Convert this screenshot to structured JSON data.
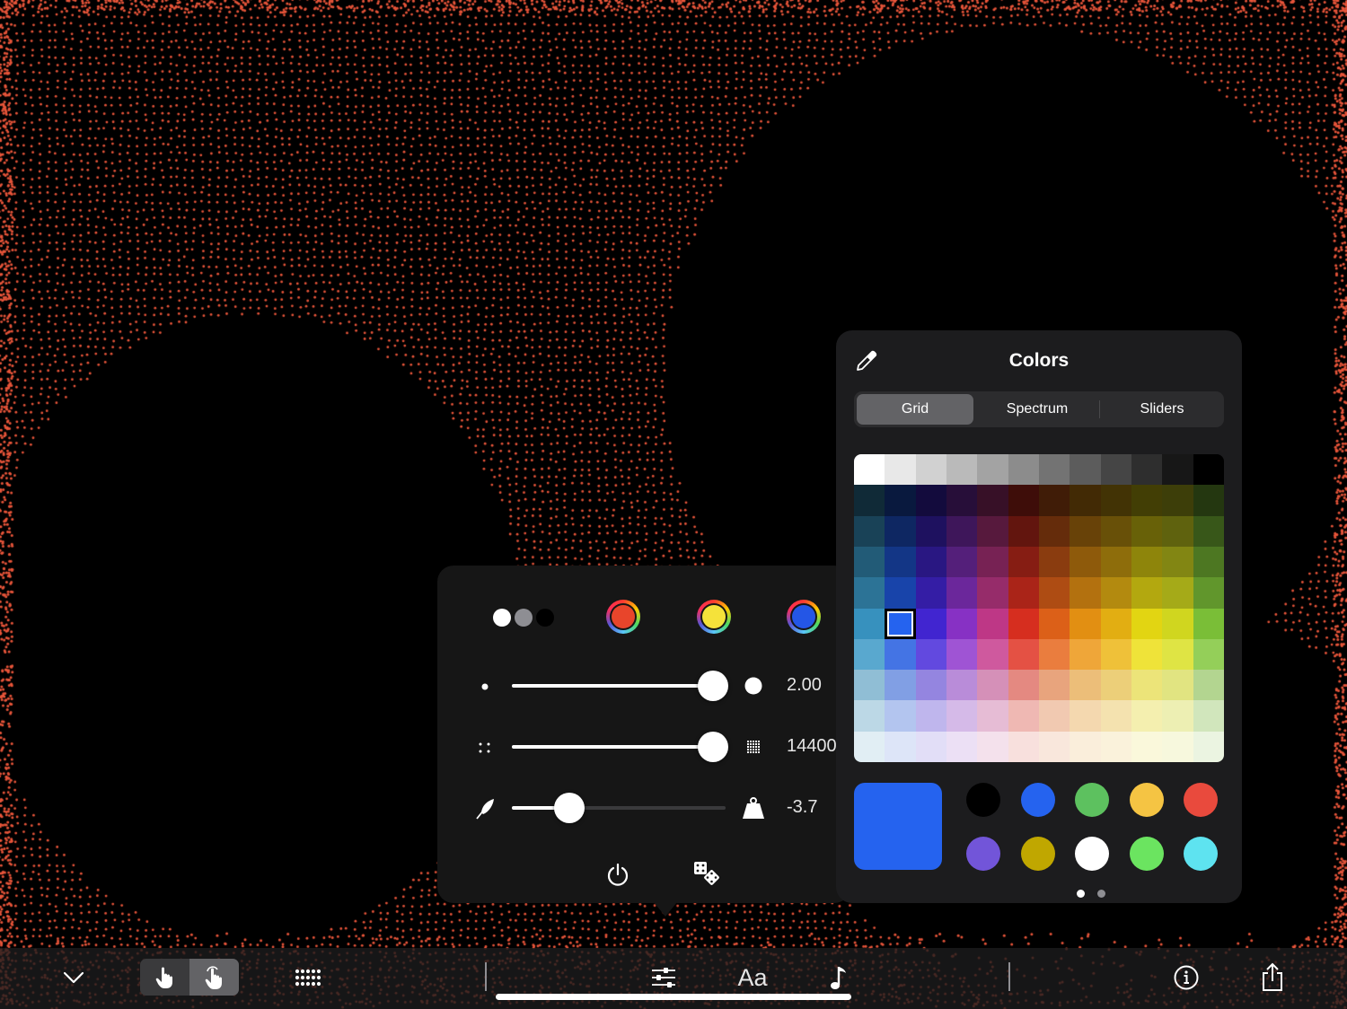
{
  "canvas": {
    "particle_color": "#e8553a",
    "background": "#000000"
  },
  "settings": {
    "point_sizes": [
      "#ffffff",
      "#8e8e93",
      "#000000"
    ],
    "active_colors": [
      {
        "name": "red",
        "color": "#e8452b"
      },
      {
        "name": "yellow",
        "color": "#f5e23a"
      },
      {
        "name": "blue",
        "color": "#2456e6"
      }
    ],
    "sliders": [
      {
        "name": "size",
        "left_icon": "small-dot-icon",
        "right_icon": "large-dot-icon",
        "fraction": 0.94,
        "value": "2.00"
      },
      {
        "name": "count",
        "left_icon": "sparse-dots-icon",
        "right_icon": "dense-grid-icon",
        "fraction": 0.94,
        "value": "14400"
      },
      {
        "name": "gravity",
        "left_icon": "feather-icon",
        "right_icon": "weight-icon",
        "fraction": 0.27,
        "value": "-3.7"
      }
    ],
    "bottom_buttons": [
      "power-icon",
      "shuffle-icon"
    ]
  },
  "colors": {
    "title": "Colors",
    "tabs": [
      "Grid",
      "Spectrum",
      "Sliders"
    ],
    "selected_tab": "Grid",
    "selected_cell": {
      "row": 5,
      "col": 1
    },
    "current_color": "#2563ef",
    "favorites": [
      "#000000",
      "#2563ef",
      "#5dc15f",
      "#f5c443",
      "#e94a3d",
      "#7255d9",
      "#c0a700",
      "#ffffff",
      "#6be460",
      "#5ee3f0"
    ],
    "page_dots": [
      "#ffffff",
      "#8e8e93"
    ]
  },
  "toolbar": {
    "font_label": "Aa"
  }
}
